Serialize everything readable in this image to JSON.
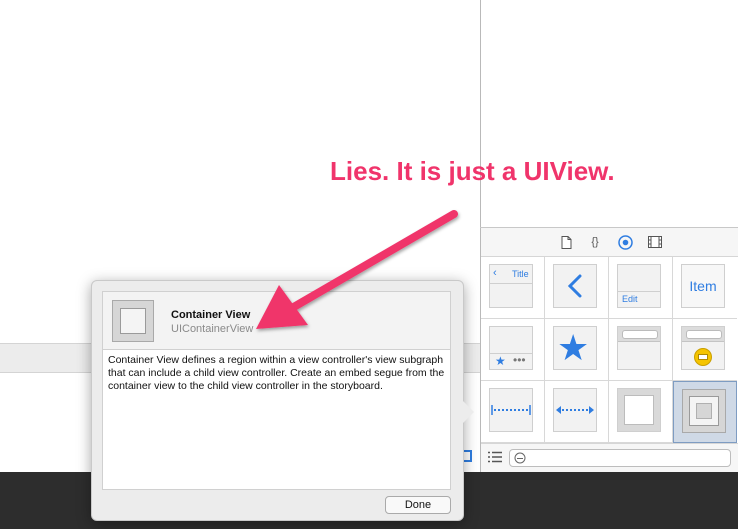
{
  "annotation": {
    "text": "Lies. It is just a UIView.",
    "color": "#f0346b"
  },
  "library": {
    "tabs": [
      {
        "icon": "file-icon"
      },
      {
        "icon": "code-braces-icon",
        "label": "{}"
      },
      {
        "icon": "object-library-icon",
        "selected": true
      },
      {
        "icon": "media-library-icon"
      }
    ],
    "items": [
      {
        "name": "navigation-bar",
        "label": "Title"
      },
      {
        "name": "back-button"
      },
      {
        "name": "toolbar",
        "label": "Edit"
      },
      {
        "name": "bar-button-item",
        "label": "Item"
      },
      {
        "name": "tab-bar"
      },
      {
        "name": "tab-bar-item"
      },
      {
        "name": "search-bar"
      },
      {
        "name": "search-bar-scope"
      },
      {
        "name": "fixed-space-bar-button"
      },
      {
        "name": "flexible-space-bar-button"
      },
      {
        "name": "view"
      },
      {
        "name": "container-view",
        "selected": true
      }
    ],
    "accent": "#2f7de1"
  },
  "popover": {
    "title": "Container View",
    "class_name": "UIContainerView",
    "description": "Container View defines a region within a view controller's view subgraph that can include a child view controller. Create an embed segue from the container view to the child view controller in the storyboard.",
    "done_label": "Done"
  }
}
